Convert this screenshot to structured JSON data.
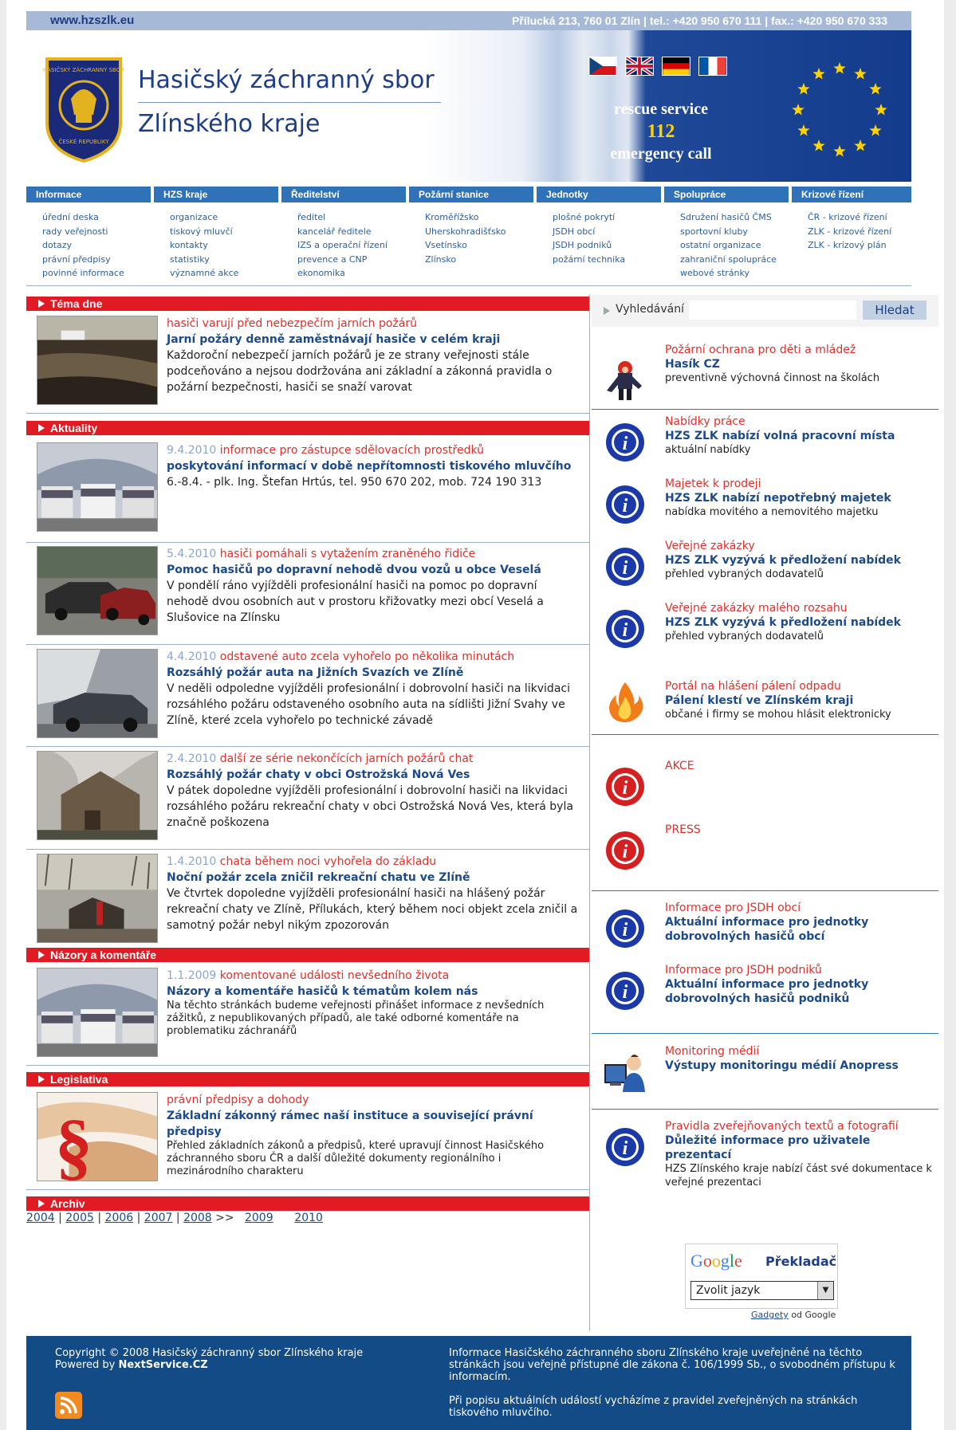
{
  "topbar": {
    "site": "www.hzszlk.eu",
    "address": "Přílucká 213, 760 01 Zlín | tel.: +420 950 670 111 | fax.: +420 950 670 333"
  },
  "header": {
    "title_line1": "Hasičský záchranný sbor",
    "title_line2": "Zlínského kraje",
    "rescue_line1": "rescue service",
    "rescue_number": "112",
    "rescue_line2": "emergency call",
    "logo_text_top": "HASIČSKÝ ZÁCHRANNÝ SBOR",
    "logo_text_bottom": "ČESKÉ REPUBLIKY"
  },
  "nav": [
    {
      "label": "Informace",
      "items": [
        "úřední deska",
        "rady veřejnosti",
        "dotazy",
        "právní předpisy",
        "povinné informace"
      ]
    },
    {
      "label": "HZS kraje",
      "items": [
        "organizace",
        "tiskový mluvčí",
        "kontakty",
        "statistiky",
        "významné akce"
      ]
    },
    {
      "label": "Ředitelství",
      "items": [
        "ředitel",
        "kancelář ředitele",
        "IZS a operační řízení",
        "prevence a CNP",
        "ekonomika"
      ]
    },
    {
      "label": "Požární stanice",
      "items": [
        "Kroměřížsko",
        "Uherskohradišťsko",
        "Vsetínsko",
        "Zlínsko"
      ]
    },
    {
      "label": "Jednotky",
      "items": [
        "plošné pokrytí",
        "JSDH obcí",
        "JSDH podniků",
        "požární technika"
      ]
    },
    {
      "label": "Spolupráce",
      "items": [
        "Sdružení hasičů ČMS",
        "sportovní kluby",
        "ostatní organizace",
        "zahraniční spolupráce",
        "webové stránky"
      ]
    },
    {
      "label": "Krizové řízení",
      "items": [
        "ČR - krizové řízení",
        "ZLK - krizové řízení",
        "ZLK - krizový plán"
      ]
    }
  ],
  "sections": {
    "tema": "Téma dne",
    "aktuality": "Aktuality",
    "nazory": "Názory a komentáře",
    "legislativa": "Legislativa",
    "archiv": "Archiv"
  },
  "tema_item": {
    "kicker": "hasiči varují před nebezpečím jarních požárů",
    "title": "Jarní požáry denně zaměstnávají hasiče v celém kraji",
    "desc": "Každoroční nebezpečí jarních požárů je ze strany veřejnosti stále podceňováno a nejsou dodržována ani základní a zákonná pravidla o požární bezpečnosti, hasiči se snaží varovat"
  },
  "aktuality": [
    {
      "date": "9.4.2010",
      "kicker": "informace pro zástupce sdělovacích prostředků",
      "title": "poskytování informací v době nepřítomnosti tiskového mluvčího",
      "desc": "6.-8.4. - plk. Ing. Štefan Hrtús, tel. 950 670 202, mob. 724 190 313"
    },
    {
      "date": "5.4.2010",
      "kicker": "hasiči pomáhali s vytažením zraněného řidiče",
      "title": "Pomoc hasičů po dopravní nehodě dvou vozů u obce Veselá",
      "desc": "V pondělí ráno vyjížděli profesionální hasiči na pomoc po dopravní nehodě dvou osobních aut v prostoru křižovatky mezi obcí Veselá a Slušovice na Zlínsku"
    },
    {
      "date": "4.4.2010",
      "kicker": "odstavené auto zcela vyhořelo po několika minutách",
      "title": "Rozsáhlý požár auta na Jižních Svazích ve Zlíně",
      "desc": "V neděli odpoledne vyjížděli profesionální i dobrovolní hasiči na likvidaci rozsáhlého požáru odstaveného osobního auta na sídlišti Jižní Svahy ve Zlíně, které zcela vyhořelo po technické závadě"
    },
    {
      "date": "2.4.2010",
      "kicker": "další ze série nekončících jarních požárů chat",
      "title": "Rozsáhlý požár chaty v obci Ostrožská Nová Ves",
      "desc": "V pátek dopoledne vyjížděli profesionální i dobrovolní hasiči na likvidaci rozsáhlého požáru rekreační chaty v obci Ostrožská Nová Ves, která byla značně poškozena"
    },
    {
      "date": "1.4.2010",
      "kicker": "chata během noci vyhořela do základu",
      "title": "Noční požár zcela zničil rekreační chatu ve Zlíně",
      "desc": "Ve čtvrtek dopoledne vyjížděli profesionální hasiči na hlášený požár rekreační chaty ve Zlíně, Přílukách, který během noci objekt zcela zničil a samotný požár nebyl nikým zpozorován"
    }
  ],
  "nazory_item": {
    "date": "1.1.2009",
    "kicker": "komentované události nevšedního života",
    "title": "Názory a komentáře hasičů k tématům kolem nás",
    "desc": "Na těchto stránkách budeme veřejnosti přinášet informace z nevšedních zážitků, z nepublikovaných případů, ale také odborné komentáře na problematiku záchranářů"
  },
  "legislativa_item": {
    "kicker": "právní předpisy a dohody",
    "title": "Základní zákonný rámec naší instituce a související právní předpisy",
    "desc": "Přehled základních zákonů a předpisů, které upravují činnost Hasičského záchranného sboru ČR a další důležité dokumenty regionálního i mezinárodního charakteru"
  },
  "archive": {
    "years_linked": [
      "2004",
      "2005",
      "2006",
      "2007",
      "2008"
    ],
    "sep": ">>",
    "years_extra": [
      "2009",
      "2010"
    ]
  },
  "search": {
    "label": "Vyhledávání",
    "button": "Hledat",
    "value": ""
  },
  "right": [
    {
      "icon": "hasik-icon",
      "kicker": "Požární ochrana pro děti a mládež",
      "title": "Hasík CZ",
      "desc": "preventivně výchovná činnost na školách"
    },
    {
      "icon": "info-blue-icon",
      "kicker": "Nabídky práce",
      "title": "HZS ZLK nabízí volná pracovní místa",
      "desc": "aktuální nabídky"
    },
    {
      "icon": "info-blue-icon",
      "kicker": "Majetek k prodeji",
      "title": "HZS ZLK nabízí nepotřebný majetek",
      "desc": "nabídka movitého a nemovitého majetku"
    },
    {
      "icon": "info-blue-icon",
      "kicker": "Veřejné zakázky",
      "title": "HZS ZLK vyzývá k předložení nabídek",
      "desc": "přehled vybraných dodavatelů"
    },
    {
      "icon": "info-blue-icon",
      "kicker": "Veřejné zakázky malého rozsahu",
      "title": "HZS ZLK vyzývá k předložení nabídek",
      "desc": "přehled vybraných dodavatelů"
    },
    {
      "icon": "fire-icon",
      "kicker": "Portál na hlášení pálení odpadu",
      "title": "Pálení klestí ve Zlínském kraji",
      "desc": "občané i firmy se mohou hlásit elektronicky"
    },
    {
      "icon": "info-red-icon",
      "kicker": "AKCE",
      "title": "",
      "desc": ""
    },
    {
      "icon": "info-red-icon",
      "kicker": "PRESS",
      "title": "",
      "desc": ""
    },
    {
      "icon": "info-blue-icon",
      "kicker": "Informace pro JSDH obcí",
      "title": "Aktuální informace pro jednotky dobrovolných hasičů obcí",
      "desc": ""
    },
    {
      "icon": "info-blue-icon",
      "kicker": "Informace pro JSDH podniků",
      "title": "Aktuální informace pro jednotky dobrovolných hasičů podniků",
      "desc": ""
    },
    {
      "icon": "monitoring-icon",
      "kicker": "Monitoring médií",
      "title": "Výstupy monitoringu médií Anopress",
      "desc": ""
    },
    {
      "icon": "info-blue-icon",
      "kicker": "Pravidla zveřejňovaných textů a fotografií",
      "title": "Důležité informace pro uživatele prezentací",
      "desc": "HZS Zlínského kraje nabízí část své dokumentace k veřejné prezentaci"
    }
  ],
  "translate": {
    "google": "Google",
    "label": "Překladač",
    "select": "Zvolit jazyk",
    "gadgets": "Gadgety",
    "od": "od Google"
  },
  "footer": {
    "copyright": "Copyright © 2008 Hasičský záchranný sbor Zlínského kraje",
    "powered_prefix": "Powered by ",
    "powered_brand": "NextService.CZ",
    "info1": "Informace Hasičského záchranného sboru Zlínského kraje uveřejněné na těchto stránkách jsou veřejně přístupné dle zákona č. 106/1999 Sb., o svobodném přístupu k informacím.",
    "info2": "Při popisu aktuálních událostí vycházíme z pravidel zveřejněných na stránkách tiskového mluvčího."
  },
  "colors": {
    "primary_blue": "#1d3e86",
    "accent_red": "#e01b23",
    "nav_blue": "#2f72b7",
    "footer_blue": "#134b86"
  }
}
